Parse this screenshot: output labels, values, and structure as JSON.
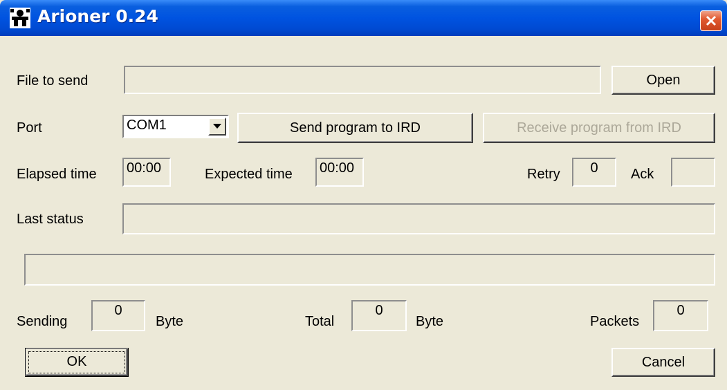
{
  "window": {
    "title": "Arioner 0.24"
  },
  "file": {
    "label": "File to send",
    "value": "",
    "open_label": "Open"
  },
  "port": {
    "label": "Port",
    "selected": "COM1",
    "send_label": "Send program to IRD",
    "receive_label": "Receive program from IRD"
  },
  "timing": {
    "elapsed_label": "Elapsed time",
    "elapsed_value": "00:00",
    "expected_label": "Expected time",
    "expected_value": "00:00",
    "retry_label": "Retry",
    "retry_value": "0",
    "ack_label": "Ack",
    "ack_value": ""
  },
  "status": {
    "label": "Last status",
    "value": ""
  },
  "progress": {
    "fraction": 0
  },
  "counts": {
    "sending_label": "Sending",
    "sending_value": "0",
    "sending_unit": "Byte",
    "total_label": "Total",
    "total_value": "0",
    "total_unit": "Byte",
    "packets_label": "Packets",
    "packets_value": "0"
  },
  "actions": {
    "ok_label": "OK",
    "cancel_label": "Cancel"
  },
  "colors": {
    "titlebar": "#0053e0",
    "face": "#ece9d8",
    "close": "#e15a32"
  },
  "icons": {
    "app": "app-icon",
    "close": "close-icon",
    "dropdown": "chevron-down-icon"
  }
}
